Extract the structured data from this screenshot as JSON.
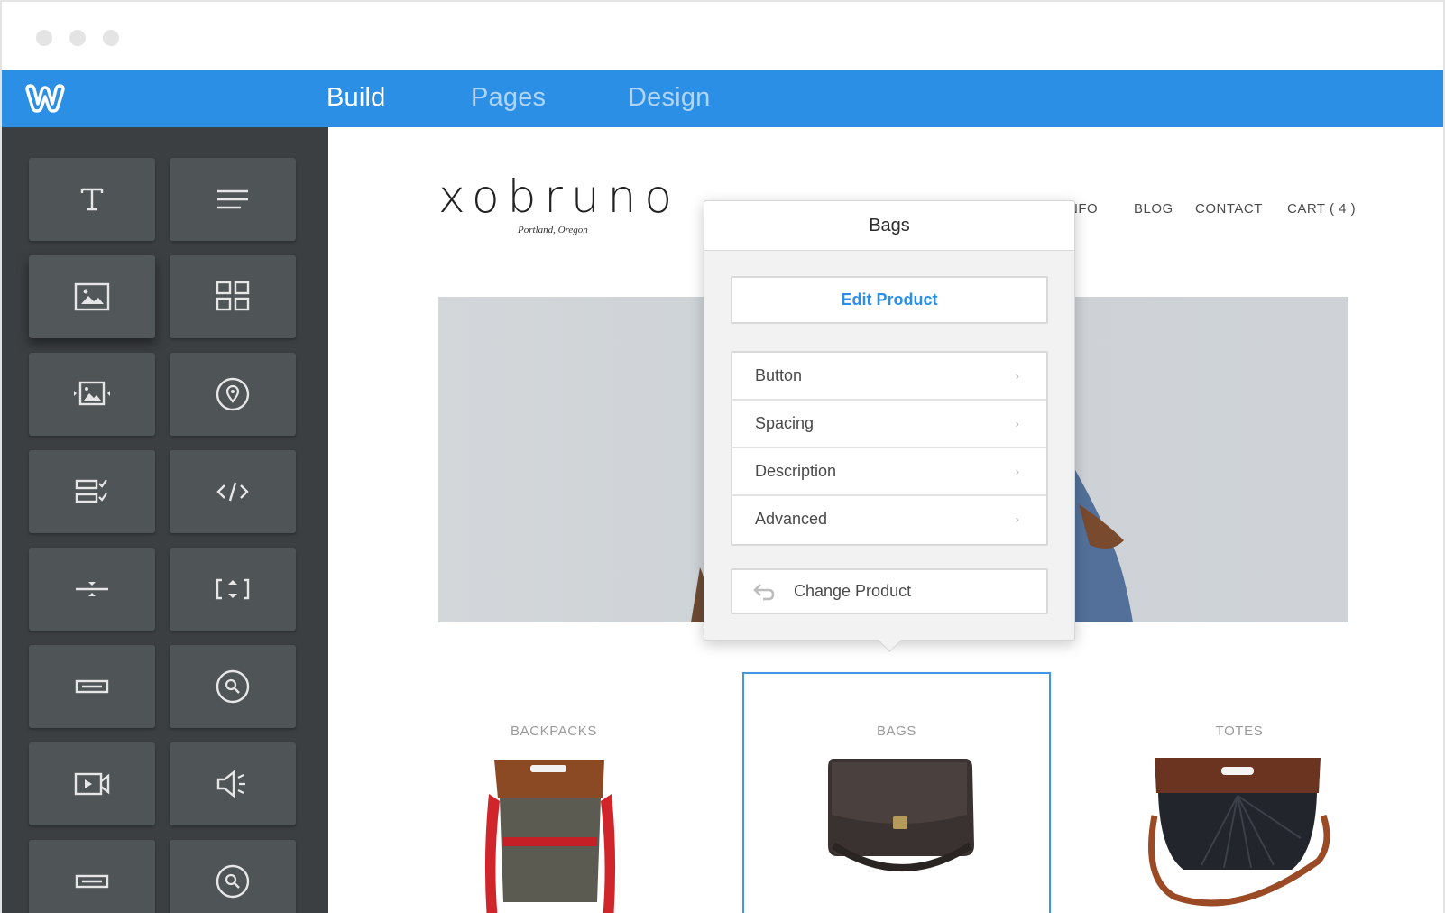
{
  "app": {
    "tabs": [
      {
        "label": "Build",
        "active": true
      },
      {
        "label": "Pages",
        "active": false
      },
      {
        "label": "Design",
        "active": false
      }
    ],
    "accent": "#2b8fe6",
    "logo_icon": "weebly-w-icon"
  },
  "sidebar": {
    "tools": [
      "title-icon",
      "paragraph-icon",
      "image-icon",
      "gallery-icon",
      "slideshow-icon",
      "map-icon",
      "contact-form-icon",
      "embed-code-icon",
      "divider-icon",
      "spacer-icon",
      "button-icon",
      "search-icon",
      "video-icon",
      "audio-icon",
      "button-icon",
      "search-icon"
    ]
  },
  "site": {
    "logo": "xobruno",
    "tagline": "Portland, Oregon",
    "nav": [
      "NFO",
      "BLOG",
      "CONTACT",
      "CART ( 4 )"
    ],
    "categories": [
      "BACKPACKS",
      "BAGS",
      "TOTES"
    ]
  },
  "popover": {
    "title": "Bags",
    "edit_label": "Edit Product",
    "menu": [
      {
        "label": "Button",
        "icon": "chevron-right-icon"
      },
      {
        "label": "Spacing",
        "icon": "chevron-right-icon"
      },
      {
        "label": "Description",
        "icon": "chevron-right-icon"
      },
      {
        "label": "Advanced",
        "icon": "chevron-right-icon"
      }
    ],
    "change_label": "Change Product",
    "change_icon": "swap-arrow-icon"
  }
}
